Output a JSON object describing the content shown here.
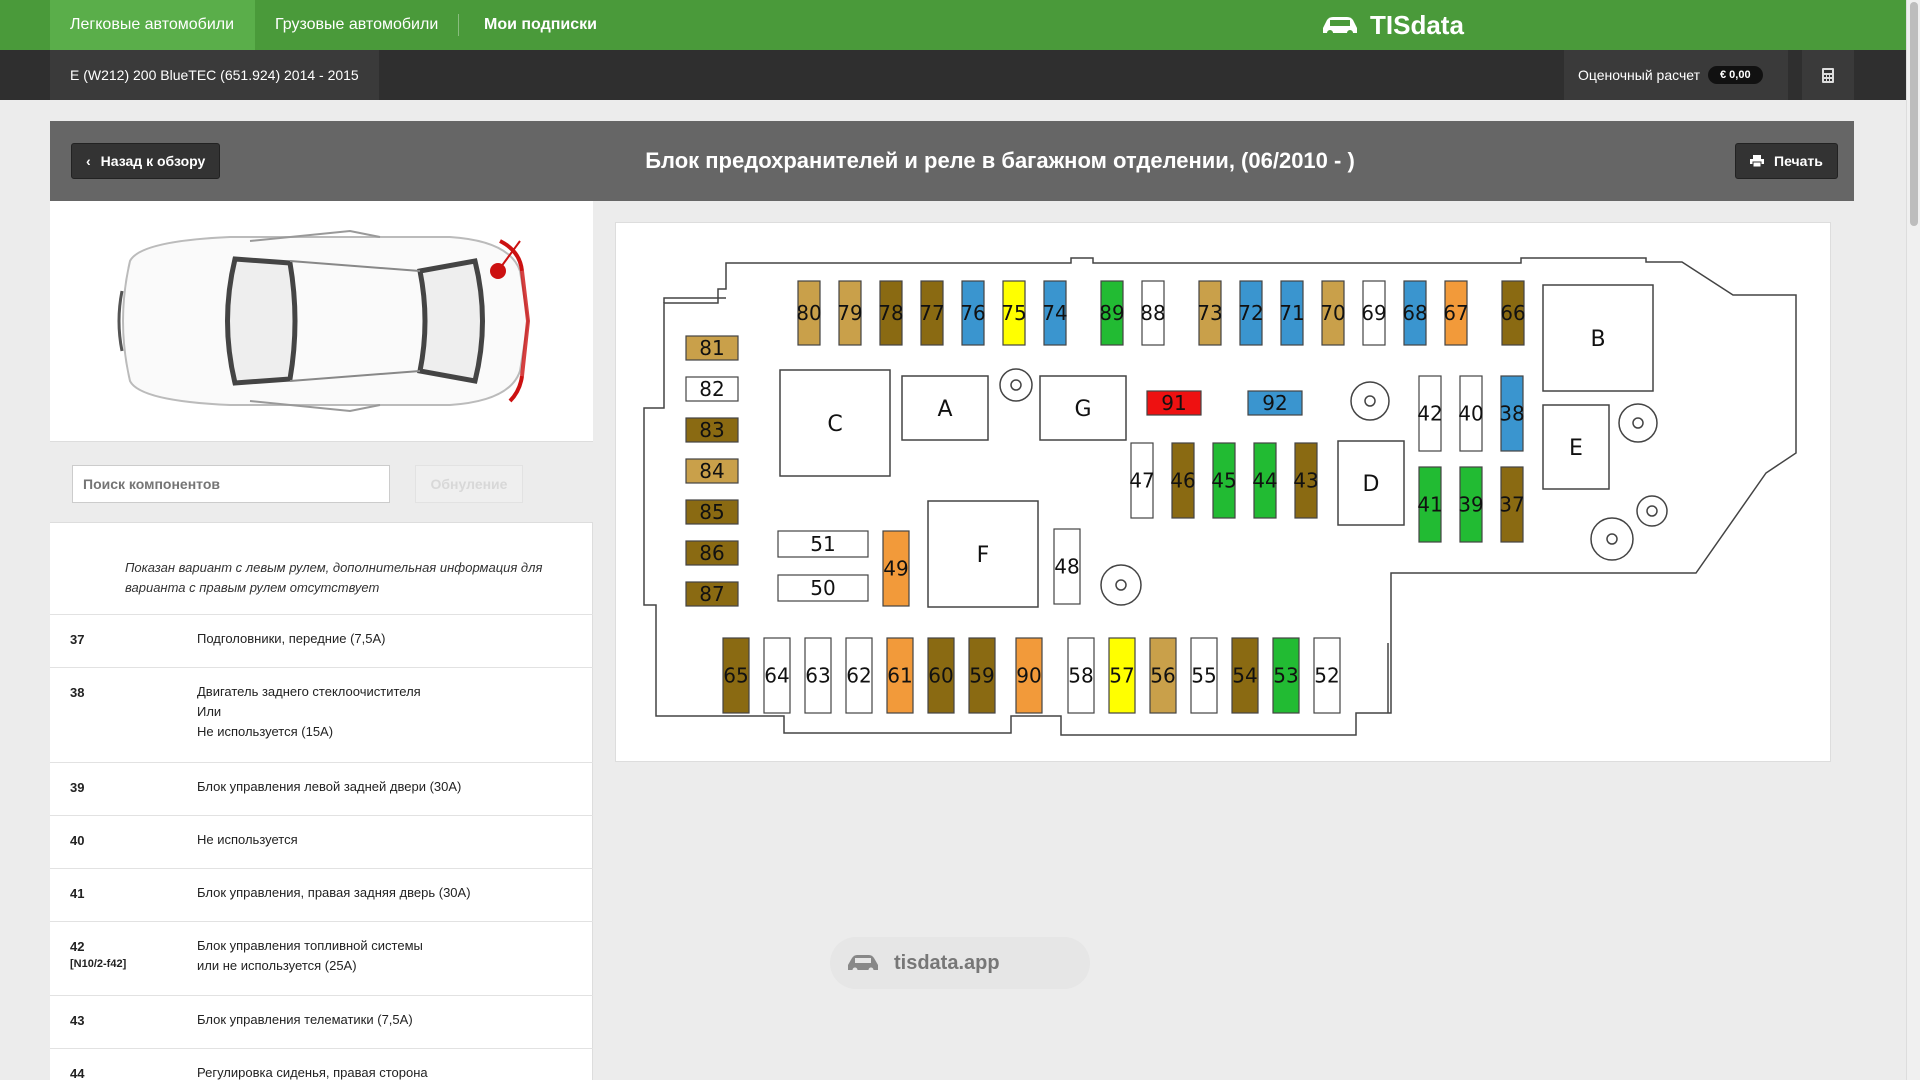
{
  "nav": {
    "tabs": [
      {
        "label": "Легковые автомобили"
      },
      {
        "label": "Грузовые автомобили"
      },
      {
        "label": "Мои подписки"
      }
    ],
    "logo": "TISdata"
  },
  "subnav": {
    "vehicle": "E (W212) 200 BlueTEC (651.924) 2014 - 2015",
    "estimate_label": "Оценочный расчет",
    "estimate_value": "€ 0,00"
  },
  "header": {
    "back_label": "Назад к обзору",
    "title": "Блок предохранителей и реле в багажном отделении, (06/2010 - )",
    "print_label": "Печать"
  },
  "search": {
    "placeholder": "Поиск компонентов",
    "reset_label": "Обнуление"
  },
  "note": "Показан вариант с левым рулем, дополнительная информация для варианта с правым рулем отсутствует",
  "fuse_list": [
    {
      "num": "37",
      "sub": "",
      "lines": [
        "Подголовники, передние (7,5A)"
      ]
    },
    {
      "num": "38",
      "sub": "",
      "lines": [
        "Двигатель заднего стеклоочистителя",
        "Или",
        "Не используется (15A)"
      ]
    },
    {
      "num": "39",
      "sub": "",
      "lines": [
        "Блок управления левой задней двери (30A)"
      ]
    },
    {
      "num": "40",
      "sub": "",
      "lines": [
        "Не используется"
      ]
    },
    {
      "num": "41",
      "sub": "",
      "lines": [
        "Блок управления, правая задняя дверь (30A)"
      ]
    },
    {
      "num": "42",
      "sub": "[N10/2-f42]",
      "lines": [
        "Блок управления топливной системы",
        "или не используется (25A)"
      ]
    },
    {
      "num": "43",
      "sub": "",
      "lines": [
        "Блок управления телематики (7,5A)"
      ]
    },
    {
      "num": "44",
      "sub": "",
      "lines": [
        "Регулировка сиденья, правая сторона"
      ]
    }
  ],
  "watermark": "tisdata.app",
  "colors": {
    "nav_green": "#4a9a3a",
    "tan": "#c9a04a",
    "brown": "#8a6a12",
    "blue": "#3a95cf",
    "yellow": "#ffff00",
    "green": "#22bb33",
    "orange": "#f29a3a",
    "red": "#ee1111",
    "white": "#ffffff"
  },
  "fuses": [
    {
      "label": "80",
      "color": "tan"
    },
    {
      "label": "79",
      "color": "tan"
    },
    {
      "label": "78",
      "color": "brown"
    },
    {
      "label": "77",
      "color": "brown"
    },
    {
      "label": "76",
      "color": "blue"
    },
    {
      "label": "75",
      "color": "yellow"
    },
    {
      "label": "74",
      "color": "blue"
    },
    {
      "label": "89",
      "color": "green"
    },
    {
      "label": "88",
      "color": "white"
    },
    {
      "label": "73",
      "color": "tan"
    },
    {
      "label": "72",
      "color": "blue"
    },
    {
      "label": "71",
      "color": "blue"
    },
    {
      "label": "70",
      "color": "tan"
    },
    {
      "label": "69",
      "color": "white"
    },
    {
      "label": "68",
      "color": "blue"
    },
    {
      "label": "67",
      "color": "orange"
    },
    {
      "label": "66",
      "color": "brown"
    },
    {
      "label": "81",
      "color": "tan"
    },
    {
      "label": "82",
      "color": "white"
    },
    {
      "label": "83",
      "color": "brown"
    },
    {
      "label": "84",
      "color": "tan"
    },
    {
      "label": "85",
      "color": "brown"
    },
    {
      "label": "86",
      "color": "brown"
    },
    {
      "label": "87",
      "color": "brown"
    },
    {
      "label": "91",
      "color": "red"
    },
    {
      "label": "92",
      "color": "blue"
    },
    {
      "label": "42",
      "color": "white"
    },
    {
      "label": "40",
      "color": "white"
    },
    {
      "label": "38",
      "color": "blue"
    },
    {
      "label": "47",
      "color": "white"
    },
    {
      "label": "46",
      "color": "brown"
    },
    {
      "label": "45",
      "color": "green"
    },
    {
      "label": "44",
      "color": "green"
    },
    {
      "label": "43",
      "color": "brown"
    },
    {
      "label": "41",
      "color": "green"
    },
    {
      "label": "39",
      "color": "green"
    },
    {
      "label": "37",
      "color": "brown"
    },
    {
      "label": "51",
      "color": "white"
    },
    {
      "label": "50",
      "color": "white"
    },
    {
      "label": "49",
      "color": "orange"
    },
    {
      "label": "48",
      "color": "white"
    },
    {
      "label": "65",
      "color": "brown"
    },
    {
      "label": "64",
      "color": "white"
    },
    {
      "label": "63",
      "color": "white"
    },
    {
      "label": "62",
      "color": "white"
    },
    {
      "label": "61",
      "color": "orange"
    },
    {
      "label": "60",
      "color": "brown"
    },
    {
      "label": "59",
      "color": "brown"
    },
    {
      "label": "90",
      "color": "orange"
    },
    {
      "label": "58",
      "color": "white"
    },
    {
      "label": "57",
      "color": "yellow"
    },
    {
      "label": "56",
      "color": "tan"
    },
    {
      "label": "55",
      "color": "white"
    },
    {
      "label": "54",
      "color": "brown"
    },
    {
      "label": "53",
      "color": "green"
    },
    {
      "label": "52",
      "color": "white"
    }
  ],
  "relays": [
    {
      "label": "A"
    },
    {
      "label": "B"
    },
    {
      "label": "C"
    },
    {
      "label": "D"
    },
    {
      "label": "E"
    },
    {
      "label": "F"
    },
    {
      "label": "G"
    }
  ]
}
